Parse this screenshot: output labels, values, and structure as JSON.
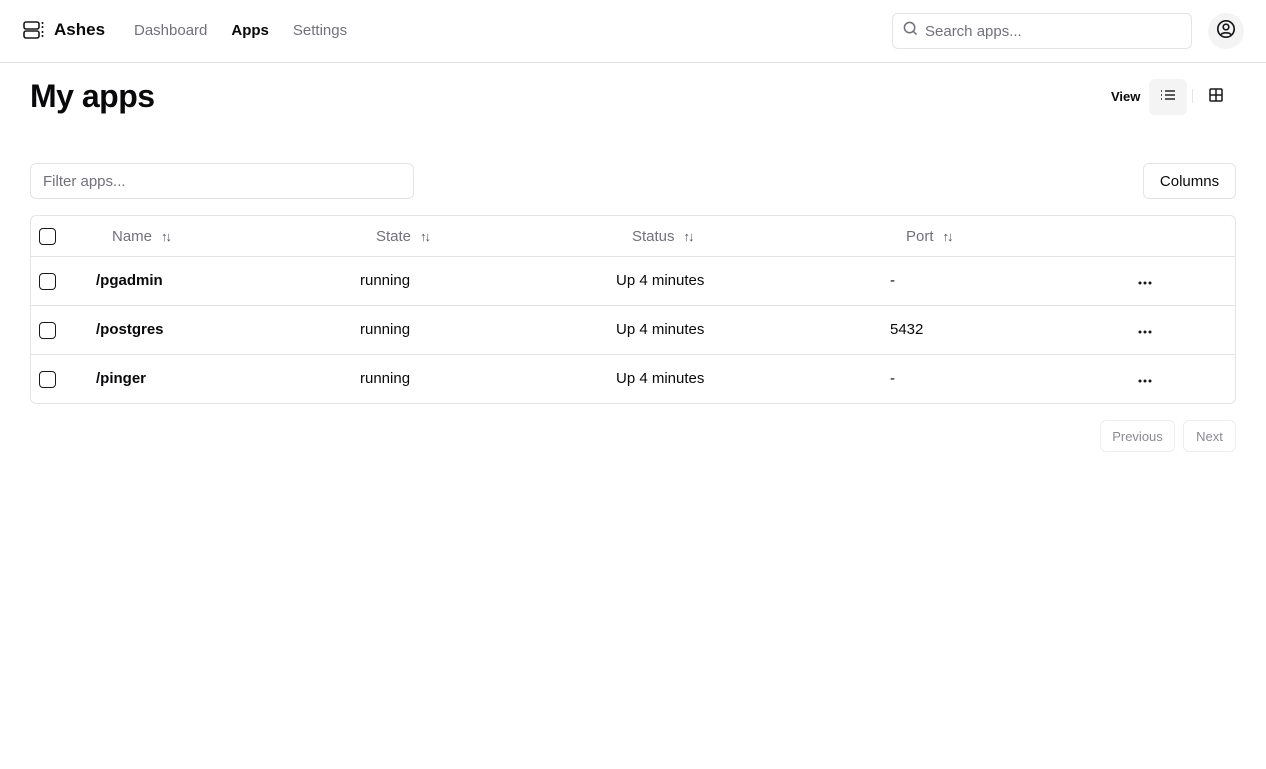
{
  "header": {
    "brand_name": "Ashes",
    "brand_icon": "server-icon",
    "nav": [
      {
        "label": "Dashboard",
        "active": false
      },
      {
        "label": "Apps",
        "active": true
      },
      {
        "label": "Settings",
        "active": false
      }
    ],
    "search": {
      "placeholder": "Search apps...",
      "value": "",
      "icon": "search-icon"
    },
    "user_icon": "user-circle-icon"
  },
  "main": {
    "title": "My apps",
    "view": {
      "label": "View",
      "options": [
        "list",
        "grid"
      ],
      "selected": "list"
    },
    "filter": {
      "placeholder": "Filter apps...",
      "value": ""
    },
    "columns_button": "Columns",
    "table": {
      "columns": [
        {
          "label": "Name",
          "sortable": true
        },
        {
          "label": "State",
          "sortable": true
        },
        {
          "label": "Status",
          "sortable": true
        },
        {
          "label": "Port",
          "sortable": true
        }
      ],
      "rows": [
        {
          "name": "/pgadmin",
          "state": "running",
          "status": "Up 4 minutes",
          "port": "-"
        },
        {
          "name": "/postgres",
          "state": "running",
          "status": "Up 4 minutes",
          "port": "5432"
        },
        {
          "name": "/pinger",
          "state": "running",
          "status": "Up 4 minutes",
          "port": "-"
        }
      ],
      "row_action_icon": "more-horizontal-icon"
    },
    "pagination": {
      "previous": "Previous",
      "next": "Next"
    }
  },
  "colors": {
    "text": "#09090b",
    "muted": "#71717a",
    "border": "#e4e4e7",
    "active_bg": "#f4f4f5"
  }
}
